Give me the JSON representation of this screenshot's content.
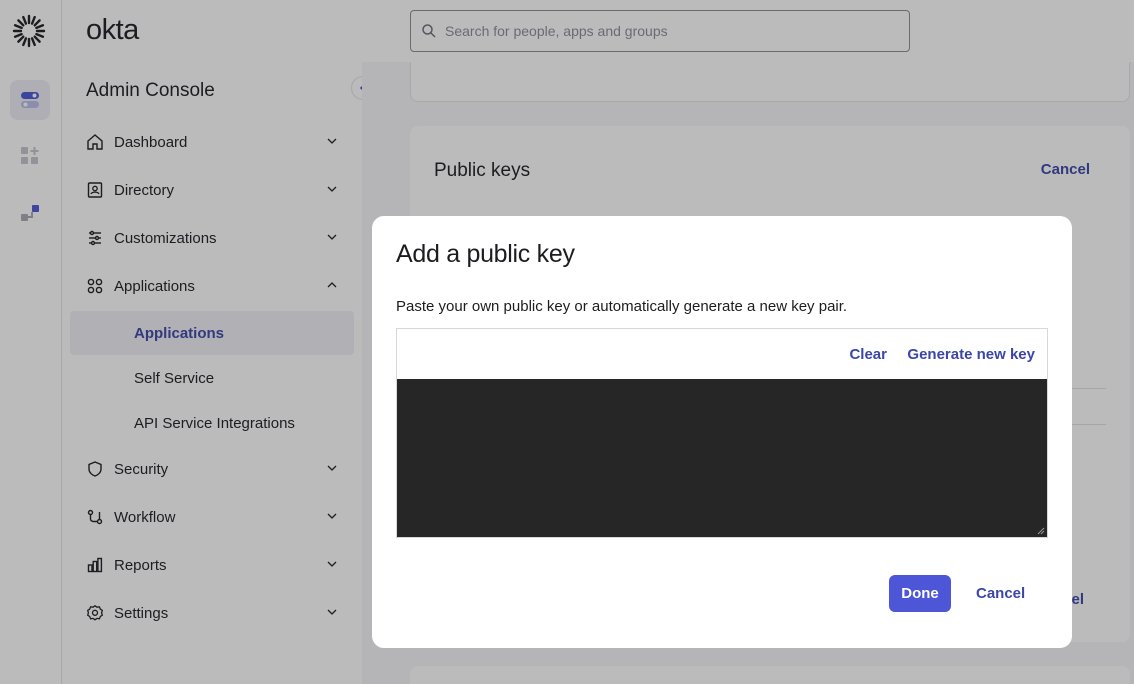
{
  "app": {
    "brand": "okta",
    "console_title": "Admin Console"
  },
  "search": {
    "placeholder": "Search for people, apps and groups"
  },
  "sidebar": {
    "items": [
      {
        "label": "Dashboard",
        "icon": "home-icon",
        "expanded": false
      },
      {
        "label": "Directory",
        "icon": "directory-icon",
        "expanded": false
      },
      {
        "label": "Customizations",
        "icon": "sliders-icon",
        "expanded": false
      },
      {
        "label": "Applications",
        "icon": "grid-icon",
        "expanded": true
      },
      {
        "label": "Security",
        "icon": "shield-icon",
        "expanded": false
      },
      {
        "label": "Workflow",
        "icon": "workflow-icon",
        "expanded": false
      },
      {
        "label": "Reports",
        "icon": "chart-icon",
        "expanded": false
      },
      {
        "label": "Settings",
        "icon": "gear-icon",
        "expanded": false
      }
    ],
    "sub_items": [
      {
        "label": "Applications",
        "active": true
      },
      {
        "label": "Self Service",
        "active": false
      },
      {
        "label": "API Service Integrations",
        "active": false
      }
    ]
  },
  "background_card": {
    "title": "Public keys",
    "cancel_label": "Cancel",
    "partial_cancel_label": "ncel"
  },
  "modal": {
    "title": "Add a public key",
    "description": "Paste your own public key or automatically generate a new key pair.",
    "clear_label": "Clear",
    "generate_label": "Generate new key",
    "key_value": "",
    "done_label": "Done",
    "cancel_label": "Cancel"
  },
  "colors": {
    "accent": "#4c56d6",
    "link": "#3c46a8",
    "key_area": "#262626"
  }
}
